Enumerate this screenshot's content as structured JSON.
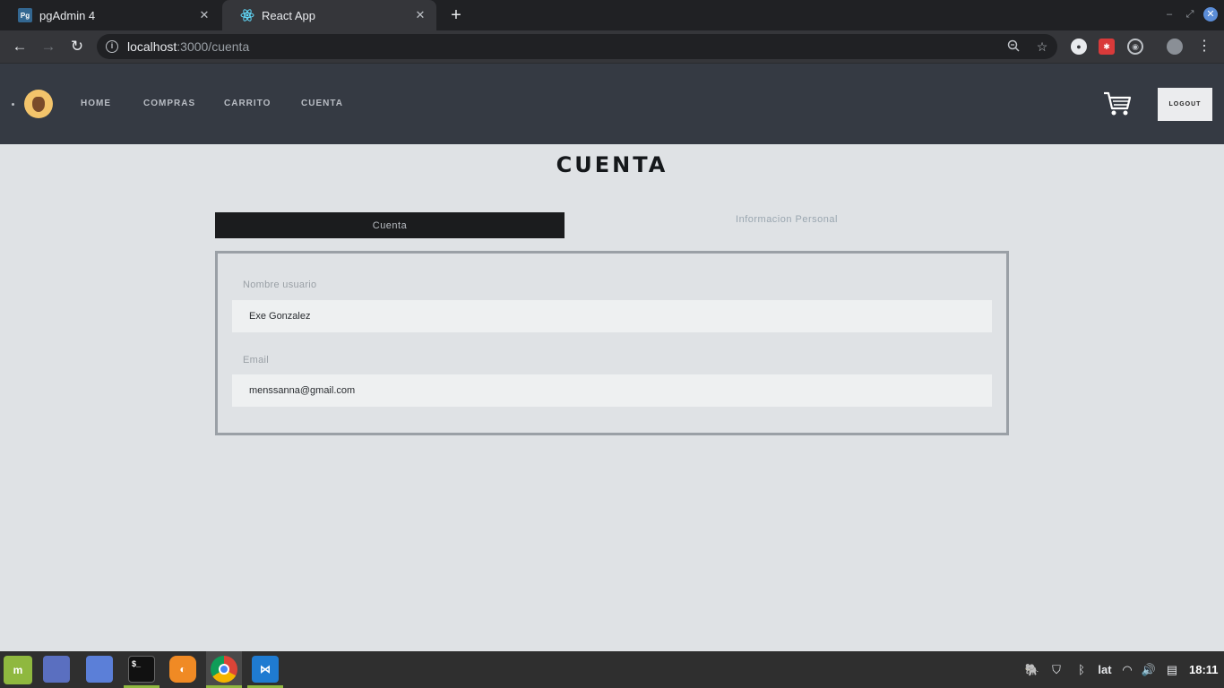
{
  "browser": {
    "tabs": [
      {
        "title": "pgAdmin 4",
        "favicon": "pg-icon",
        "active": false
      },
      {
        "title": "React App",
        "favicon": "react-icon",
        "active": true
      }
    ],
    "address": {
      "host": "localhost",
      "path": ":3000/cuenta"
    }
  },
  "header": {
    "nav": [
      "HOME",
      "COMPRAS",
      "CARRITO",
      "CUENTA"
    ],
    "logout_label": "LOGOUT",
    "logo_icon": "mate-logo-icon",
    "cart_icon": "shopping-cart-icon"
  },
  "main": {
    "title": "CUENTA",
    "tabs": [
      {
        "label": "Cuenta",
        "active": true
      },
      {
        "label": "Informacion Personal",
        "active": false
      }
    ],
    "fields": [
      {
        "label": "Nombre usuario",
        "value": "Exe Gonzalez"
      },
      {
        "label": "Email",
        "value": "menssanna@gmail.com"
      }
    ]
  },
  "taskbar": {
    "apps": [
      "mint-menu-icon",
      "files-icon",
      "folder-icon",
      "terminal-icon",
      "firefox-icon",
      "chrome-icon",
      "vscode-icon"
    ],
    "keyboard_layout": "lat",
    "clock": "18:11"
  },
  "colors": {
    "header_bg": "#353a43",
    "page_bg": "#dfe2e5",
    "active_tab_bg": "#1b1c1e",
    "panel_border": "#9aa0a6"
  }
}
